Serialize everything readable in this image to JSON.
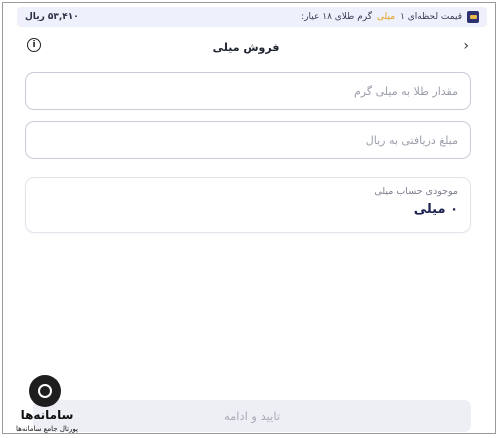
{
  "price_bar": {
    "prefix": "قیمت لحظه‌ای ۱",
    "unit_highlight": "میلی",
    "suffix": "گرم طلای ۱۸ عیار:",
    "price": "۵۳,۴۱۰ ریال",
    "icon": "gold-icon"
  },
  "header": {
    "title": "فروش میلی",
    "info_icon": "info-icon",
    "back_icon": "chevron-right-icon"
  },
  "form": {
    "amount_placeholder": "مقدار طلا به میلی گرم",
    "receive_placeholder": "مبلغ دریافتی به ریال"
  },
  "balance": {
    "label": "موجودی حساب میلی",
    "value": "۰ میلی"
  },
  "confirm_label": "تایید و ادامه",
  "watermark": {
    "title": "سامانه‌ها",
    "subtitle": "پورتال جامع سامانه‌ها"
  },
  "colors": {
    "accent_gold": "#e0a020",
    "brand_navy": "#2d3170",
    "disabled_button_bg": "#eeeff4"
  }
}
